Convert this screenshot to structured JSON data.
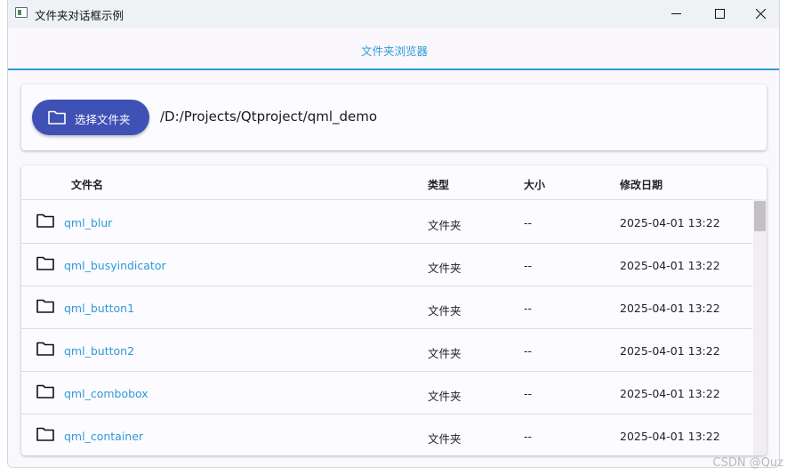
{
  "window": {
    "title": "文件夹对话框示例",
    "controls": {
      "minimize": "minimize-icon",
      "maximize": "maximize-icon",
      "close": "close-icon"
    }
  },
  "tab": {
    "label": "文件夹浏览器"
  },
  "toolbar": {
    "choose_folder_label": "选择文件夹",
    "current_path": "/D:/Projects/Qtproject/qml_demo"
  },
  "table": {
    "headers": {
      "name": "文件名",
      "type": "类型",
      "size": "大小",
      "modified": "修改日期"
    },
    "rows": [
      {
        "name": "qml_blur",
        "type": "文件夹",
        "size": "--",
        "modified": "2025-04-01 13:22"
      },
      {
        "name": "qml_busyindicator",
        "type": "文件夹",
        "size": "--",
        "modified": "2025-04-01 13:22"
      },
      {
        "name": "qml_button1",
        "type": "文件夹",
        "size": "--",
        "modified": "2025-04-01 13:22"
      },
      {
        "name": "qml_button2",
        "type": "文件夹",
        "size": "--",
        "modified": "2025-04-01 13:22"
      },
      {
        "name": "qml_combobox",
        "type": "文件夹",
        "size": "--",
        "modified": "2025-04-01 13:22"
      },
      {
        "name": "qml_container",
        "type": "文件夹",
        "size": "--",
        "modified": "2025-04-01 13:22"
      }
    ]
  },
  "colors": {
    "accent": "#2e9bd6",
    "button": "#3f51b5"
  },
  "watermark": "CSDN @Quz"
}
